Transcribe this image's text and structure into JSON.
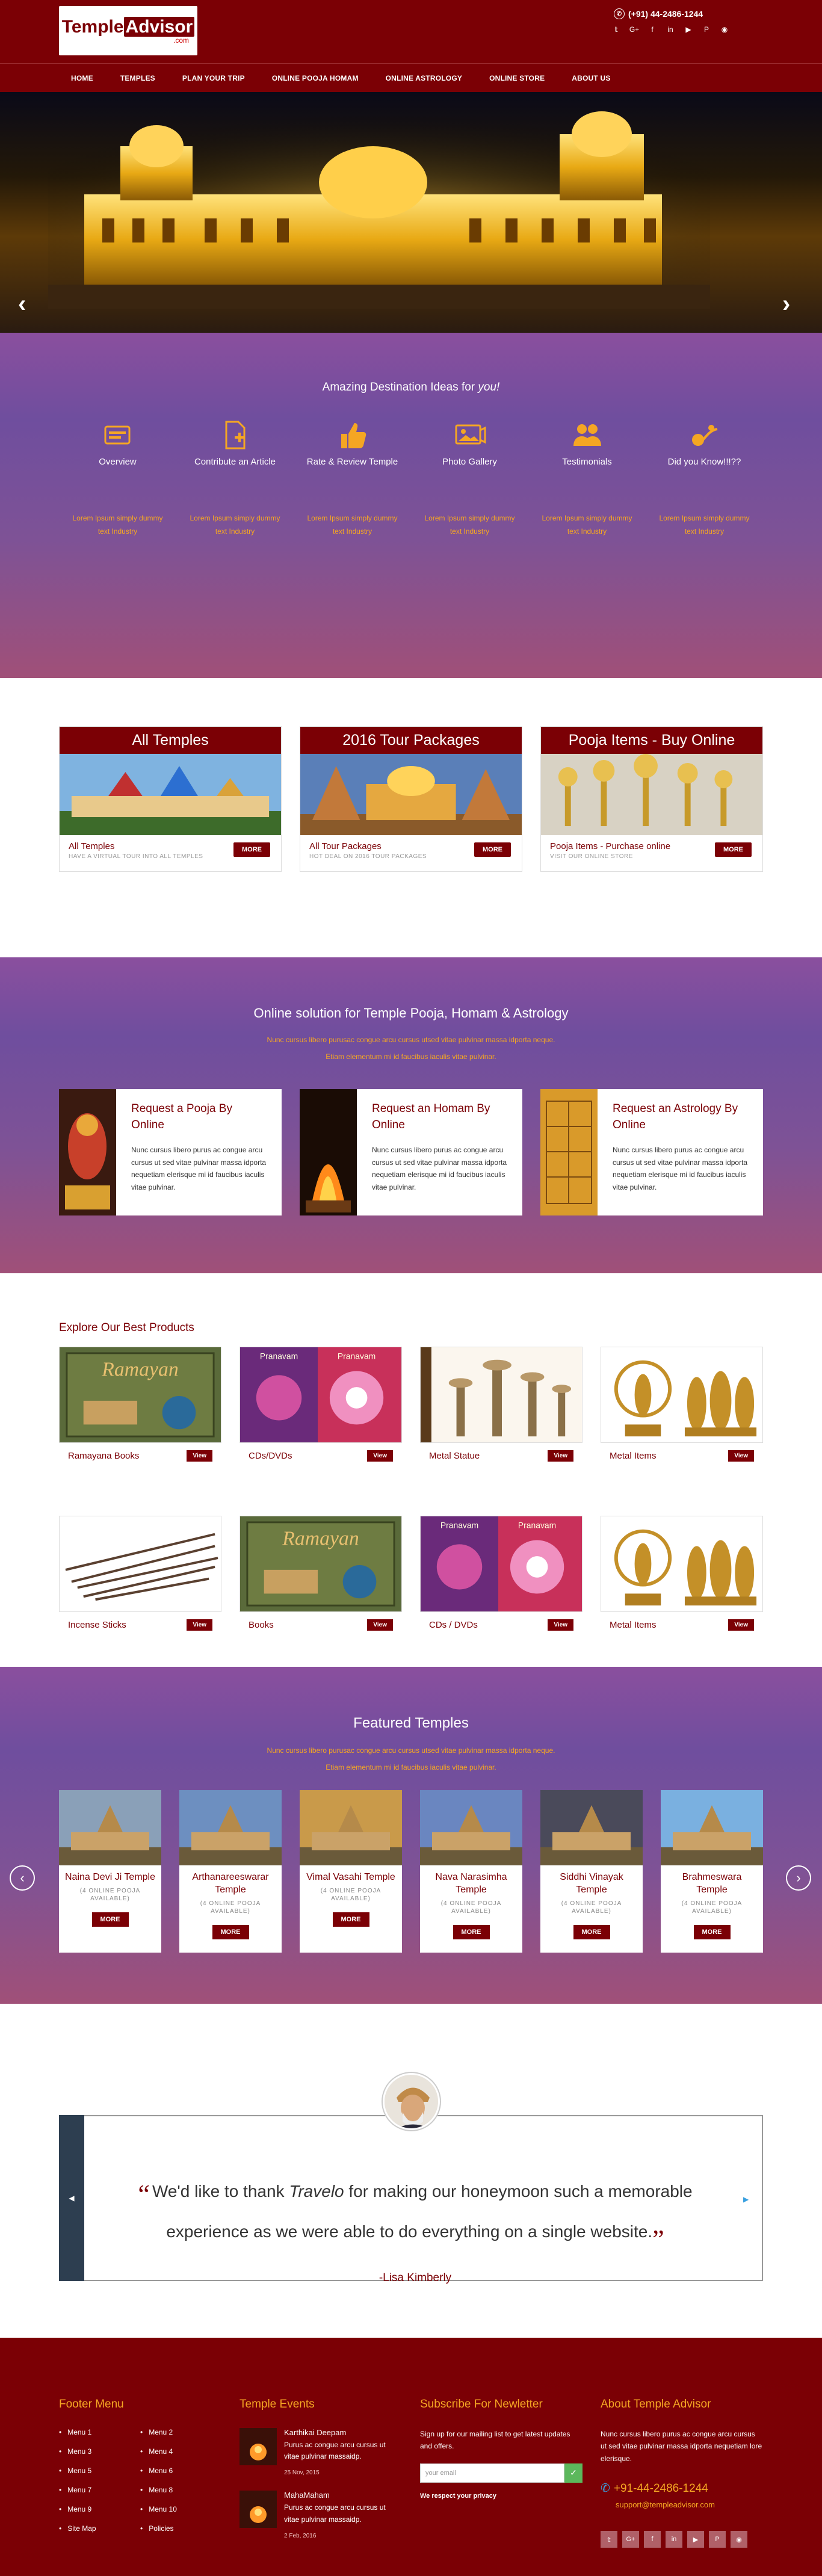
{
  "header": {
    "logo_main": "Temple",
    "logo_accent": "Advisor",
    "logo_sub": ".com",
    "phone": "(+91) 44-2486-1244",
    "socials": [
      "twitter-icon",
      "google-plus-icon",
      "facebook-icon",
      "linkedin-icon",
      "youtube-icon",
      "pinterest-icon",
      "rss-icon"
    ],
    "social_glyphs": [
      "𝕥",
      "G+",
      "f",
      "in",
      "▶",
      "P",
      "◉"
    ]
  },
  "nav": [
    "HOME",
    "TEMPLES",
    "PLAN YOUR TRIP",
    "ONLINE POOJA  HOMAM",
    "ONLINE ASTROLOGY",
    "ONLINE STORE",
    "ABOUT US"
  ],
  "hero": {
    "prev": "‹",
    "next": "›"
  },
  "ideas": {
    "heading": "Amazing Destination Ideas for",
    "heading_em": "you!",
    "items": [
      {
        "title": "Overview",
        "desc": "Lorem Ipsum simply dummy text Industry"
      },
      {
        "title": "Contribute an Article",
        "desc": "Lorem Ipsum simply dummy text Industry"
      },
      {
        "title": "Rate & Review Temple",
        "desc": "Lorem Ipsum simply dummy text Industry"
      },
      {
        "title": "Photo Gallery",
        "desc": "Lorem Ipsum simply dummy text Industry"
      },
      {
        "title": "Testimonials",
        "desc": "Lorem Ipsum simply dummy text Industry"
      },
      {
        "title": "Did you Know!!!??",
        "desc": "Lorem Ipsum simply dummy text Industry"
      }
    ]
  },
  "categories": [
    {
      "head": "All Temples",
      "title": "All Temples",
      "sub": "HAVE A VIRTUAL TOUR INTO ALL TEMPLES",
      "btn": "MORE"
    },
    {
      "head": "2016 Tour Packages",
      "title": "All Tour Packages",
      "sub": "HOT DEAL ON 2016 TOUR PACKAGES",
      "btn": "MORE"
    },
    {
      "head": "Pooja Items - Buy Online",
      "title": "Pooja Items - Purchase online",
      "sub": "VISIT OUR ONLINE STORE",
      "btn": "MORE"
    }
  ],
  "online": {
    "heading": "Online solution for Temple Pooja, Homam & Astrology",
    "sub1": "Nunc cursus libero purusac congue arcu cursus utsed vitae pulvinar massa idporta neque.",
    "sub2": "Etiam elementum mi id faucibus iaculis vitae pulvinar.",
    "cards": [
      {
        "title": "Request a Pooja By Online",
        "desc": "Nunc cursus libero purus ac congue arcu cursus ut sed vitae pulvinar massa idporta nequetiam elerisque mi id faucibus iaculis vitae pulvinar."
      },
      {
        "title": "Request an Homam By Online",
        "desc": "Nunc cursus libero purus ac congue arcu cursus ut sed vitae pulvinar massa idporta nequetiam elerisque mi id faucibus iaculis vitae pulvinar."
      },
      {
        "title": "Request an Astrology By Online",
        "desc": "Nunc cursus libero purus ac congue arcu cursus ut sed vitae pulvinar massa idporta nequetiam elerisque mi id faucibus iaculis vitae pulvinar."
      }
    ]
  },
  "products": {
    "heading": "Explore Our Best Products",
    "view": "View",
    "items": [
      {
        "name": "Ramayana Books",
        "kind": "book"
      },
      {
        "name": "CDs/DVDs",
        "kind": "cd"
      },
      {
        "name": "Metal Statue",
        "kind": "lamp"
      },
      {
        "name": "Metal Items",
        "kind": "statue"
      },
      {
        "name": "Incense Sticks",
        "kind": "incense"
      },
      {
        "name": "Books",
        "kind": "book"
      },
      {
        "name": "CDs / DVDs",
        "kind": "cd"
      },
      {
        "name": "Metal Items",
        "kind": "statue"
      }
    ],
    "book_text": "Ramayan",
    "cd_text": "Pranavam"
  },
  "featured": {
    "heading": "Featured Temples",
    "sub1": "Nunc cursus libero purusac congue arcu cursus utsed vitae pulvinar massa idporta neque.",
    "sub2": "Etiam elementum mi id faucibus iaculis vitae pulvinar.",
    "sub_label": "(4 ONLINE POOJA AVAILABLE)",
    "btn": "MORE",
    "temples": [
      "Naina Devi Ji Temple",
      "Arthanareeswarar Temple",
      "Vimal Vasahi Temple",
      "Nava Narasimha Temple",
      "Siddhi Vinayak Temple",
      "Brahmeswara Temple"
    ]
  },
  "testimonial": {
    "q_open": "“",
    "q_close": "”",
    "before": "We'd like to thank ",
    "em": "Travelo",
    "after": " for making our honeymoon such a memorable experience as we were able to do everything on a single website.",
    "author": "-Lisa Kimberly"
  },
  "footer": {
    "menu_title": "Footer Menu",
    "menu": [
      "Menu 1",
      "Menu 2",
      "Menu 3",
      "Menu 4",
      "Menu 5",
      "Menu 6",
      "Menu 7",
      "Menu 8",
      "Menu 9",
      "Menu 10",
      "Site Map",
      "Policies"
    ],
    "events_title": "Temple Events",
    "events": [
      {
        "title": "Karthikai Deepam",
        "desc": "Purus ac congue arcu cursus ut vitae pulvinar massaidp.",
        "date": "25 Nov, 2015"
      },
      {
        "title": "MahaMaham",
        "desc": "Purus ac congue arcu cursus ut vitae pulvinar massaidp.",
        "date": "2 Feb, 2016"
      }
    ],
    "news_title": "Subscribe For Newletter",
    "news_desc": "Sign up for our mailing list to get latest updates and offers.",
    "news_placeholder": "your email",
    "news_go": "✓",
    "news_respect": "We respect your privacy",
    "about_title": "About Temple Advisor",
    "about_desc": "Nunc cursus libero purus ac congue arcu cursus ut sed vitae pulvinar massa idporta nequetiam lore elerisque.",
    "phone": "+91-44-2486-1244",
    "email": "support@templeadvisor.com",
    "social_glyphs": [
      "𝕥",
      "G+",
      "f",
      "in",
      "▶",
      "P",
      "◉"
    ]
  }
}
